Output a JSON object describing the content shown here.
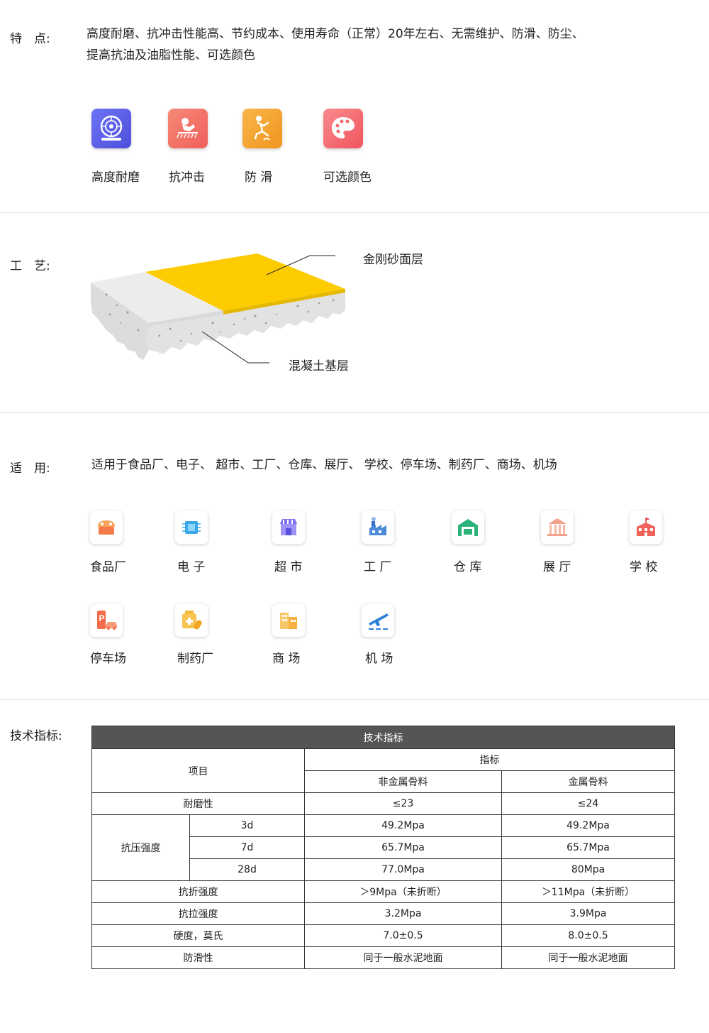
{
  "features": {
    "label": "特　点:",
    "text_line1": "高度耐磨、抗冲击性能高、节约成本、使用寿命（正常）20年左右、无需维护、防滑、防尘、",
    "text_line2": "提高抗油及油脂性能、可选颜色",
    "items": [
      {
        "label": "高度耐磨",
        "icon": "wheel-icon",
        "color": "#5b5ff0"
      },
      {
        "label": "抗冲击",
        "icon": "impact-icon",
        "color": "#f26b5b"
      },
      {
        "label": "防 滑",
        "icon": "slip-icon",
        "color": "#f4a236"
      },
      {
        "label": "可选颜色",
        "icon": "palette-icon",
        "color": "#f5636b"
      }
    ]
  },
  "process": {
    "label": "工　艺:",
    "top_layer": "金刚砂面层",
    "base_layer": "混凝土基层",
    "colors": {
      "top": "#fccc00",
      "concrete": "#e6e6e6"
    }
  },
  "applications": {
    "label": "适　用:",
    "text": "适用于食品厂、电子、 超市、工厂、仓库、展厅、 学校、停车场、制药厂、商场、机场",
    "items": [
      {
        "label": "食品厂",
        "icon": "food-factory-icon"
      },
      {
        "label": "电 子",
        "icon": "chip-icon"
      },
      {
        "label": "超 市",
        "icon": "supermarket-icon"
      },
      {
        "label": "工 厂",
        "icon": "factory-icon"
      },
      {
        "label": "仓 库",
        "icon": "warehouse-icon"
      },
      {
        "label": "展 厅",
        "icon": "exhibition-hall-icon"
      },
      {
        "label": "学 校",
        "icon": "school-icon"
      },
      {
        "label": "停车场",
        "icon": "parking-icon"
      },
      {
        "label": "制药厂",
        "icon": "pharmacy-icon"
      },
      {
        "label": "商 场",
        "icon": "mall-icon"
      },
      {
        "label": "机 场",
        "icon": "airport-icon"
      }
    ]
  },
  "specs": {
    "label": "技术指标:",
    "table_title": "技术指标",
    "col_item": "项目",
    "col_index": "指标",
    "col_nonmetal": "非金属骨料",
    "col_metal": "金属骨料",
    "rows": {
      "abrasion": {
        "name": "耐磨性",
        "nonmetal": "≤23",
        "metal": "≤24"
      },
      "compressive": {
        "name": "抗压强度",
        "d3": {
          "age": "3d",
          "nonmetal": "49.2Mpa",
          "metal": "49.2Mpa"
        },
        "d7": {
          "age": "7d",
          "nonmetal": "65.7Mpa",
          "metal": "65.7Mpa"
        },
        "d28": {
          "age": "28d",
          "nonmetal": "77.0Mpa",
          "metal": "80Mpa"
        }
      },
      "flexural": {
        "name": "抗折强度",
        "nonmetal": "＞9Mpa（未折断）",
        "metal": "＞11Mpa（未折断）"
      },
      "tensile": {
        "name": "抗拉强度",
        "nonmetal": "3.2Mpa",
        "metal": "3.9Mpa"
      },
      "hardness": {
        "name": "硬度，莫氏",
        "nonmetal": "7.0±0.5",
        "metal": "8.0±0.5"
      },
      "antislip": {
        "name": "防滑性",
        "nonmetal": "同于一般水泥地面",
        "metal": "同于一般水泥地面"
      }
    }
  }
}
